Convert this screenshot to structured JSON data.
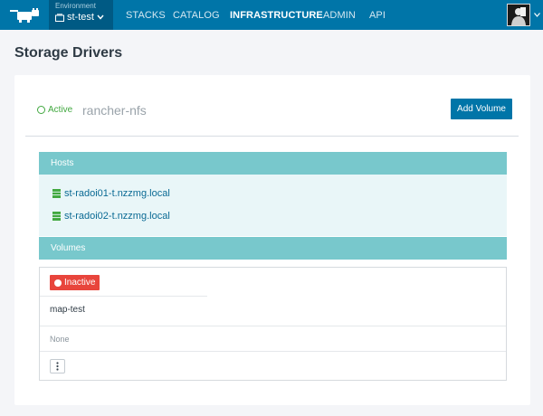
{
  "nav": {
    "environment_label": "Environment",
    "environment_value": "st-test",
    "items": [
      {
        "label": "STACKS",
        "active": false
      },
      {
        "label": "CATALOG",
        "active": false
      },
      {
        "label": "INFRASTRUCTURE",
        "active": true
      },
      {
        "label": "ADMIN",
        "active": false
      },
      {
        "label": "API",
        "active": false
      }
    ]
  },
  "page": {
    "title": "Storage Drivers"
  },
  "driver": {
    "status": "Active",
    "name": "rancher-nfs",
    "add_volume_label": "Add Volume"
  },
  "hosts": {
    "header": "Hosts",
    "items": [
      "st-radoi01-t.nzzmg.local",
      "st-radoi02-t.nzzmg.local"
    ]
  },
  "volumes": {
    "header": "Volumes",
    "items": [
      {
        "state": "Inactive",
        "name": "map-test",
        "detail": "None"
      }
    ]
  },
  "colors": {
    "nav_bg": "#0075a8",
    "env_bg": "#005a84",
    "section_header": "#78c8cc",
    "active_green": "#41a83f",
    "inactive_red": "#e8453c"
  }
}
